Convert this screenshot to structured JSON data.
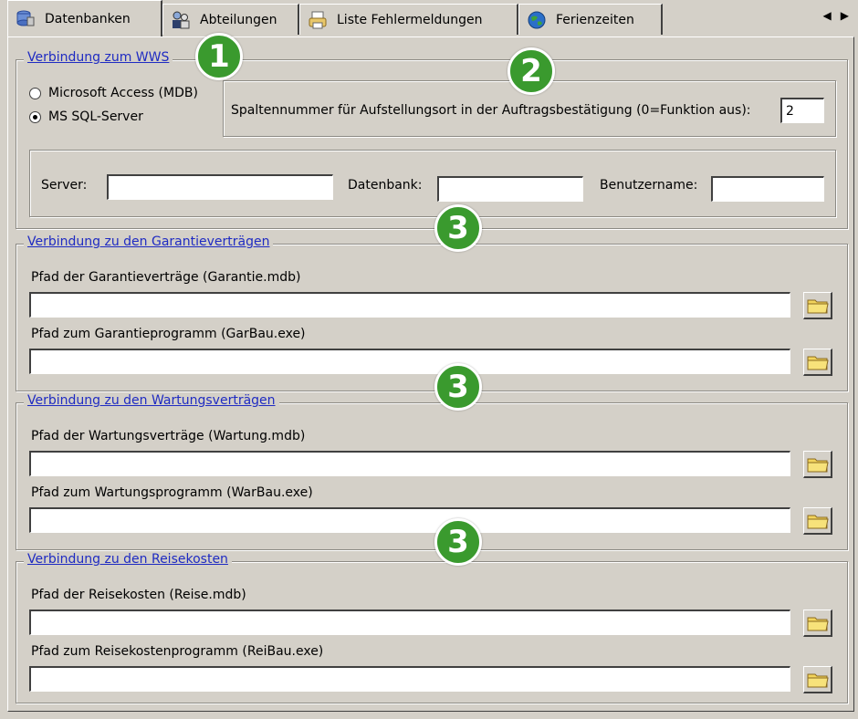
{
  "tabs": [
    {
      "label": "Datenbanken",
      "icon": "database-icon",
      "active": true
    },
    {
      "label": "Abteilungen",
      "icon": "users-icon",
      "active": false
    },
    {
      "label": "Liste Fehlermeldungen",
      "icon": "printer-icon",
      "active": false
    },
    {
      "label": "Ferienzeiten",
      "icon": "globe-icon",
      "active": false
    }
  ],
  "wws": {
    "legend": "Verbindung zum WWS",
    "radio_access": "Microsoft Access (MDB)",
    "radio_sql": "MS SQL-Server",
    "selected": "MS SQL-Server",
    "column_label": "Spaltennummer für Aufstellungsort in der Auftragsbestätigung (0=Funktion aus):",
    "column_value": "2",
    "server_label": "Server:",
    "server_value": "",
    "database_label": "Datenbank:",
    "database_value": "",
    "user_label": "Benutzername:",
    "user_value": ""
  },
  "garantie": {
    "legend": "Verbindung zu den Garantieverträgen",
    "path1_label": "Pfad der Garantieverträge (Garantie.mdb)",
    "path1_value": "",
    "path2_label": "Pfad zum Garantieprogramm (GarBau.exe)",
    "path2_value": ""
  },
  "wartung": {
    "legend": "Verbindung zu den Wartungsverträgen",
    "path1_label": "Pfad der Wartungsverträge (Wartung.mdb)",
    "path1_value": "",
    "path2_label": "Pfad zum Wartungsprogramm (WarBau.exe)",
    "path2_value": ""
  },
  "reise": {
    "legend": "Verbindung zu den Reisekosten",
    "path1_label": "Pfad der Reisekosten (Reise.mdb)",
    "path1_value": "",
    "path2_label": "Pfad zum Reisekostenprogramm (ReiBau.exe)",
    "path2_value": ""
  },
  "badges": [
    "1",
    "2",
    "3",
    "3",
    "3"
  ],
  "colors": {
    "accent_link": "#1f2bc2",
    "badge_green": "#3a9a2e",
    "window_bg": "#d4d0c8"
  }
}
